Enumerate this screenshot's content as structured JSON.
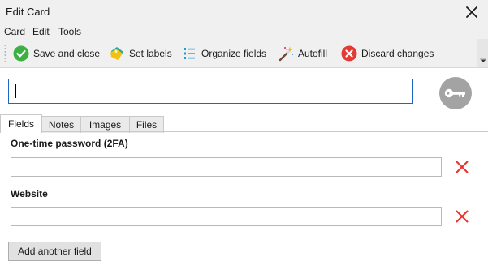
{
  "window": {
    "title": "Edit Card"
  },
  "menu": {
    "items": [
      "Card",
      "Edit",
      "Tools"
    ]
  },
  "toolbar": {
    "buttons": [
      {
        "label": "Save and close",
        "icon": "check-circle-icon"
      },
      {
        "label": "Set labels",
        "icon": "label-tag-icon"
      },
      {
        "label": "Organize fields",
        "icon": "list-icon"
      },
      {
        "label": "Autofill",
        "icon": "magic-wand-icon"
      },
      {
        "label": "Discard changes",
        "icon": "discard-circle-icon"
      }
    ]
  },
  "card": {
    "name_value": "",
    "icon": "key-icon"
  },
  "tabs": [
    {
      "label": "Fields",
      "active": true
    },
    {
      "label": "Notes",
      "active": false
    },
    {
      "label": "Images",
      "active": false
    },
    {
      "label": "Files",
      "active": false
    }
  ],
  "fields": [
    {
      "label": "One-time password (2FA)",
      "value": ""
    },
    {
      "label": "Website",
      "value": ""
    }
  ],
  "actions": {
    "add_field_label": "Add another field"
  },
  "colors": {
    "save_green": "#3cb043",
    "discard_red": "#e53935",
    "delete_red": "#e8322a",
    "accent_blue": "#1e66c4",
    "key_badge_gray": "#a3a3a3"
  }
}
